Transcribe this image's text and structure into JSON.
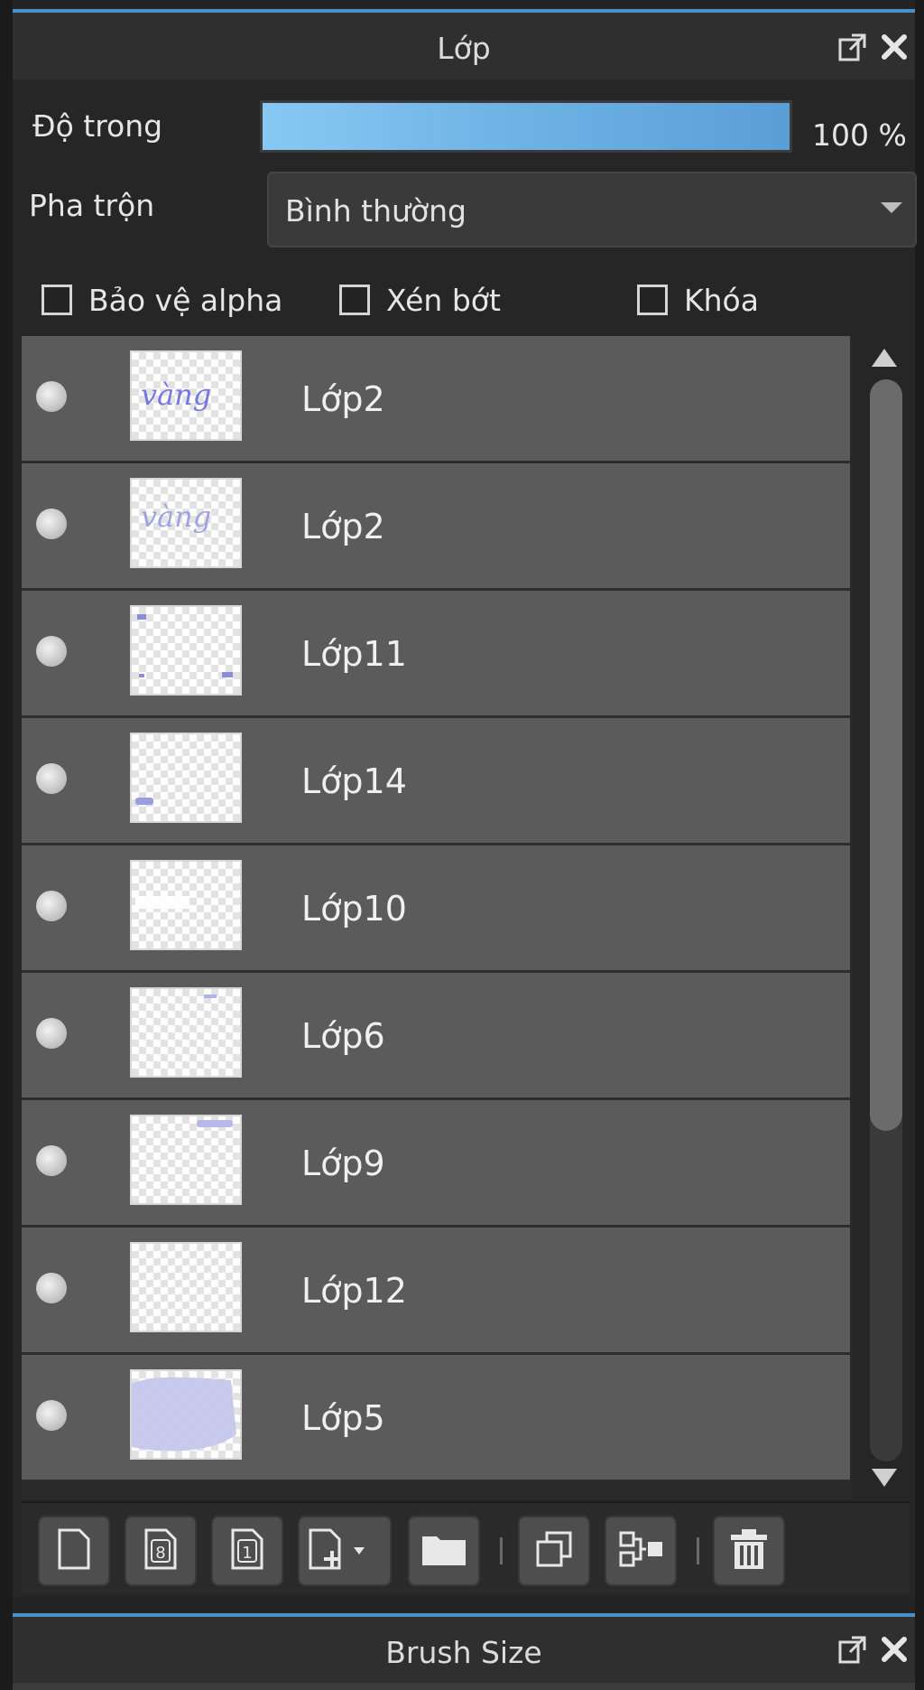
{
  "layers_panel": {
    "title": "Lớp",
    "icons": {
      "popout": "popout-icon",
      "close": "close-icon"
    },
    "opacity_label": "Độ trong",
    "opacity_value": "100 %",
    "opacity_fraction": 1.0,
    "blend_label": "Pha trộn",
    "blend_mode": "Bình thường",
    "checkboxes": [
      {
        "label": "Bảo vệ alpha",
        "checked": false
      },
      {
        "label": "Xén bớt",
        "checked": false
      },
      {
        "label": "Khóa",
        "checked": false
      }
    ],
    "layers": [
      {
        "name": "Lớp2",
        "visible": true,
        "thumb_text": "vàng"
      },
      {
        "name": "Lớp2",
        "visible": true,
        "thumb_text": "vàng"
      },
      {
        "name": "Lớp11",
        "visible": true
      },
      {
        "name": "Lớp14",
        "visible": true
      },
      {
        "name": "Lớp10",
        "visible": true
      },
      {
        "name": "Lớp6",
        "visible": true
      },
      {
        "name": "Lớp9",
        "visible": true
      },
      {
        "name": "Lớp12",
        "visible": true
      },
      {
        "name": "Lớp5",
        "visible": true
      }
    ],
    "toolbar_icons": [
      "new-layer-icon",
      "new-8bit-layer-icon",
      "new-1bit-layer-icon",
      "add-layer-menu-icon",
      "new-folder-icon",
      "duplicate-layer-icon",
      "merge-down-icon",
      "delete-layer-icon"
    ]
  },
  "brush_size_panel": {
    "title": "Brush Size",
    "icons": {
      "popout": "popout-icon",
      "close": "close-icon"
    }
  },
  "colors": {
    "accent": "#4a90c8",
    "opacity_bar_start": "#88c8f4",
    "opacity_bar_end": "#5a9ed6",
    "layer_row": "#5b5b5b",
    "thumb_ink": "#7a7fd8"
  }
}
